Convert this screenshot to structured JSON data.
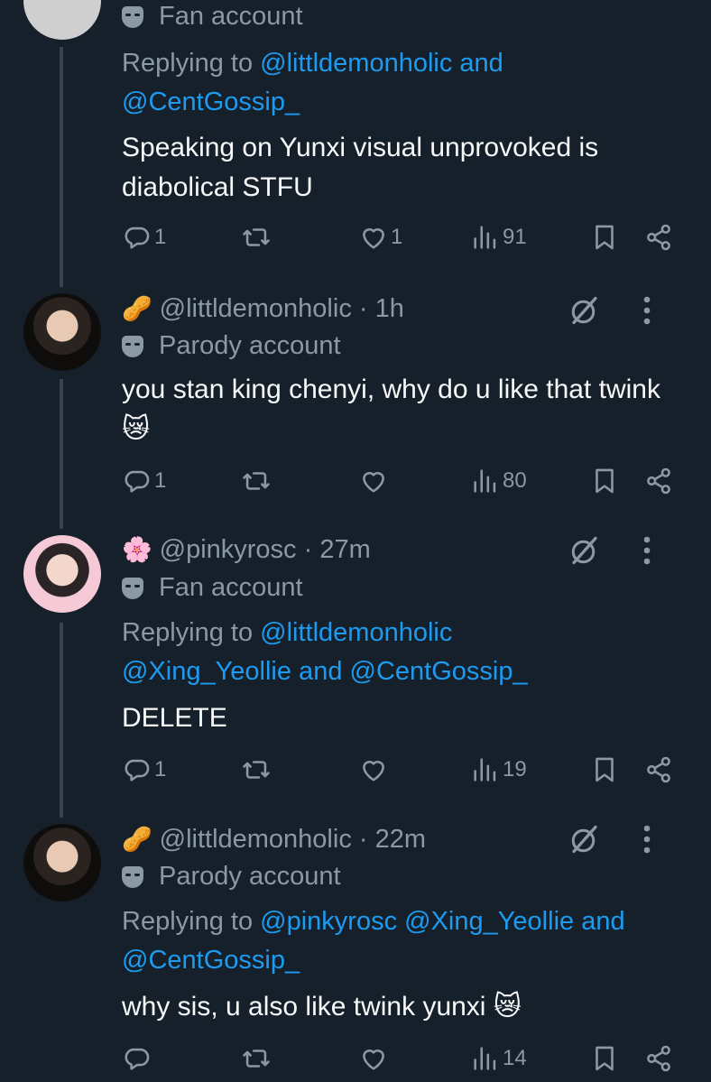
{
  "tweets": [
    {
      "account_type": "Fan account",
      "replying_prefix": "Replying to",
      "replying_mentions": [
        "@littldemonholic and",
        "@CentGossip_"
      ],
      "text": "Speaking on Yunxi visual unprovoked is diabolical STFU",
      "replies": "1",
      "retweets": "",
      "likes": "1",
      "views": "91"
    },
    {
      "emoji": "🥜",
      "handle": "@littldemonholic · 1h",
      "account_type": "Parody account",
      "text": "you stan king chenyi, why do u like that twink 😿",
      "replies": "1",
      "retweets": "",
      "likes": "",
      "views": "80"
    },
    {
      "emoji": "🌸",
      "handle": "@pinkyrosc · 27m",
      "account_type": "Fan account",
      "replying_prefix": "Replying to",
      "replying_mentions": [
        "@littldemonholic",
        "@Xing_Yeollie and @CentGossip_"
      ],
      "text": "DELETE",
      "replies": "1",
      "retweets": "",
      "likes": "",
      "views": "19"
    },
    {
      "emoji": "🥜",
      "handle": "@littldemonholic · 22m",
      "account_type": "Parody account",
      "replying_prefix": "Replying to",
      "replying_mentions": [
        "@pinkyrosc @Xing_Yeollie and",
        "@CentGossip_"
      ],
      "text": "why sis, u also like twink yunxi 😿",
      "replies": "",
      "retweets": "",
      "likes": "",
      "views": "14"
    }
  ],
  "icons": [
    "reply-icon",
    "retweet-icon",
    "like-icon",
    "views-icon",
    "bookmark-icon",
    "share-icon",
    "grok-icon",
    "more-icon",
    "mask-icon"
  ],
  "colors": {
    "background": "#15202b",
    "muted": "#8b98a5",
    "link": "#1d9bf0",
    "text": "#f7f9f9",
    "thread": "#38444d"
  }
}
